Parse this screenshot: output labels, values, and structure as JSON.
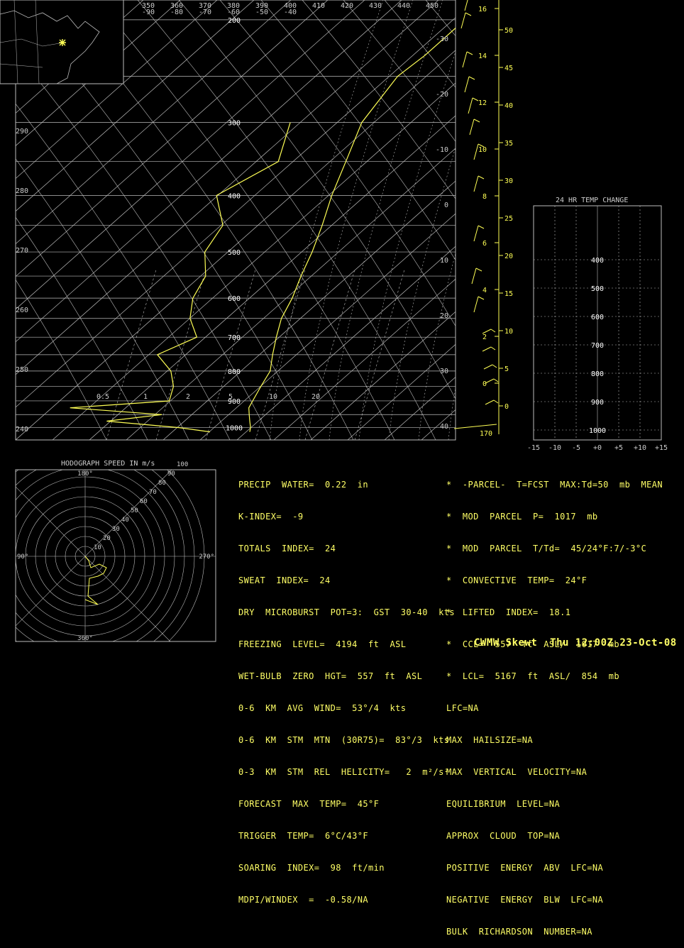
{
  "title": "CWMW Skewt  Thu 12:00Z 23-Oct-08",
  "inset_map": {
    "marker": "asterisk-marker"
  },
  "hodograph_title": "HODOGRAPH SPEED IN m/s",
  "hodograph_labels": {
    "top": "180°",
    "bottom": "360°",
    "left": "90°",
    "right": "270°"
  },
  "hodograph_speeds": [
    "10",
    "20",
    "30",
    "40",
    "50",
    "60",
    "70",
    "80",
    "90",
    "100"
  ],
  "temp_change_title": "24 HR TEMP CHANGE",
  "left_indices": [
    "PRECIP  WATER=  0.22  in",
    "K-INDEX=  -9",
    "TOTALS  INDEX=  24",
    "SWEAT  INDEX=  24",
    "DRY  MICROBURST  POT=3:  GST  30-40  kts",
    "FREEZING  LEVEL=  4194  ft  ASL",
    "WET-BULB  ZERO  HGT=  557  ft  ASL",
    "0-6  KM  AVG  WIND=  53°/4  kts",
    "0-6  KM  STM  MTN  (30R75)=  83°/3  kts",
    "0-3  KM  STM  REL  HELICITY=   2  m²/s²",
    "FORECAST  MAX  TEMP=  45°F",
    "TRIGGER  TEMP=  6°C/43°F",
    "SOARING  INDEX=  98  ft/min",
    "MDPI/WINDEX  =  -0.58/NA"
  ],
  "right_indices": [
    "*  -PARCEL-  T=FCST  MAX:Td=50  mb  MEAN",
    "*  MOD  PARCEL  P=  1017  mb",
    "*  MOD  PARCEL  T/Td=  45/24°F:7/-3°C",
    "*  CONVECTIVE  TEMP=  24°F",
    "*  LIFTED  INDEX=  18.1",
    "*  CCL=  557  ft  ASL/  1017  mb",
    "*  LCL=  5167  ft  ASL/  854  mb",
    "LFC=NA",
    "MAX  HAILSIZE=NA",
    "MAX  VERTICAL  VELOCITY=NA",
    "EQUILIBRIUM  LEVEL=NA",
    "APPROX  CLOUD  TOP=NA",
    "POSITIVE  ENERGY  ABV  LFC=NA",
    "NEGATIVE  ENERGY  BLW  LFC=NA",
    "BULK  RICHARDSON  NUMBER=NA"
  ],
  "chart_data": {
    "type": "line",
    "pressure_labels": [
      "200",
      "300",
      "400",
      "500",
      "600",
      "700",
      "800",
      "900",
      "1000"
    ],
    "theta_labels": [
      "290",
      "280",
      "270",
      "260",
      "250",
      "240"
    ],
    "top_theta_labels": [
      "350",
      "360",
      "370",
      "380",
      "390",
      "400",
      "410",
      "420",
      "430",
      "440",
      "450"
    ],
    "top_temp_labels": [
      "-90",
      "-80",
      "-70",
      "-60",
      "-50",
      "-40"
    ],
    "right_temp_labels": [
      "-30",
      "-20",
      "-10",
      "0",
      "10",
      "20",
      "30",
      "40"
    ],
    "mixing_labels": [
      "0.5",
      "1",
      "2",
      "5",
      "10",
      "20"
    ],
    "height_kft_labels": [
      "50",
      "45",
      "40",
      "35",
      "30",
      "25",
      "20",
      "15",
      "10",
      "5",
      "0"
    ],
    "height_km_labels": [
      "16",
      "14",
      "12",
      "10",
      "8",
      "6",
      "4",
      "2",
      "0"
    ],
    "height_bottom_label": "170",
    "temp_change_pressure_labels": [
      "400",
      "500",
      "600",
      "700",
      "800",
      "900",
      "1000"
    ],
    "temp_change_x_labels": [
      "-15",
      "-10",
      "-5",
      "+0",
      "+5",
      "+10",
      "+15"
    ],
    "temperature_series_color": "#ffff55",
    "dewpoint_series_color": "#ffff55",
    "grid_color": "#bbbbbb"
  }
}
